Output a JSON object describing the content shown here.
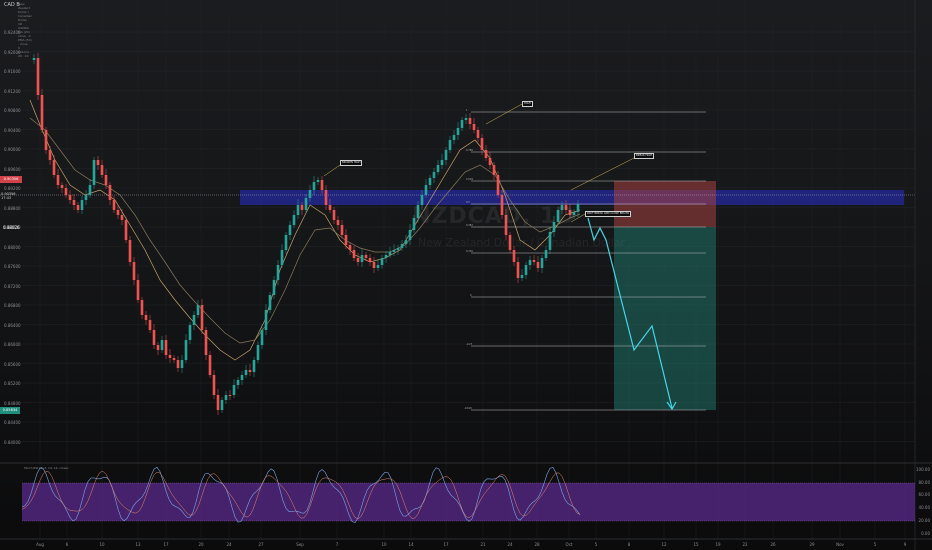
{
  "header": {
    "symbol": "CAD B",
    "chart_title": "New Zealand Dollar / Canadian Dollar · 1D · OANDA",
    "indicator_1": "MA (20) · close · 0",
    "indicator_2": "EMA (50) · close · 0",
    "indicator_3": "Volume · 20 · 20"
  },
  "watermark": {
    "symbol": "NZDCAD, 1D",
    "name": "New Zealand Dollar / Canadian Dollar"
  },
  "price_axis": {
    "ticks": [
      "0.92400",
      "0.92000",
      "0.91600",
      "0.91200",
      "0.90800",
      "0.90400",
      "0.90000",
      "0.89600",
      "0.89200",
      "0.88800",
      "0.88400",
      "0.88000",
      "0.87600",
      "0.87200",
      "0.86800",
      "0.86400",
      "0.86000",
      "0.85600",
      "0.85200",
      "0.84800",
      "0.84400",
      "0.84000"
    ],
    "current_price": "0.90356",
    "current_price_label": "0.90356",
    "current_timer": "17:43",
    "mid_price": "0.88026",
    "target_price": "0.85834"
  },
  "time_axis": {
    "ticks": [
      "Aug",
      "6",
      "10",
      "13",
      "17",
      "20",
      "24",
      "27",
      "Sep",
      "7",
      "10",
      "14",
      "17",
      "21",
      "24",
      "28",
      "Oct",
      "5",
      "8",
      "12",
      "15",
      "19",
      "22",
      "26",
      "29",
      "Nov",
      "5",
      "9"
    ]
  },
  "callouts": {
    "high": "HIGH",
    "broken_high": "BROKEN HIGH",
    "break_high": "BREAK HIGH",
    "entry_note": "WAIT BREAK AND CLOSE BELOW"
  },
  "fib_levels": [
    "1",
    "0.786",
    "0.618",
    "0.5",
    "0.382",
    "0.236",
    "0",
    "-0.27",
    "-0.618"
  ],
  "oscillator": {
    "title": "Stoch RSI (3, 3, 14, 14, close)",
    "ticks": [
      "100.00",
      "80.00",
      "60.00",
      "40.00",
      "20.00",
      "0.00"
    ]
  },
  "colors": {
    "bull": "#26a69a",
    "bear": "#ef5350",
    "zone_blue": "#2a2fd0",
    "risk_red": "#b84a4a",
    "reward_teal": "#1e6e63",
    "projection": "#44d6e8",
    "osc_band": "#5a2a8c"
  }
}
